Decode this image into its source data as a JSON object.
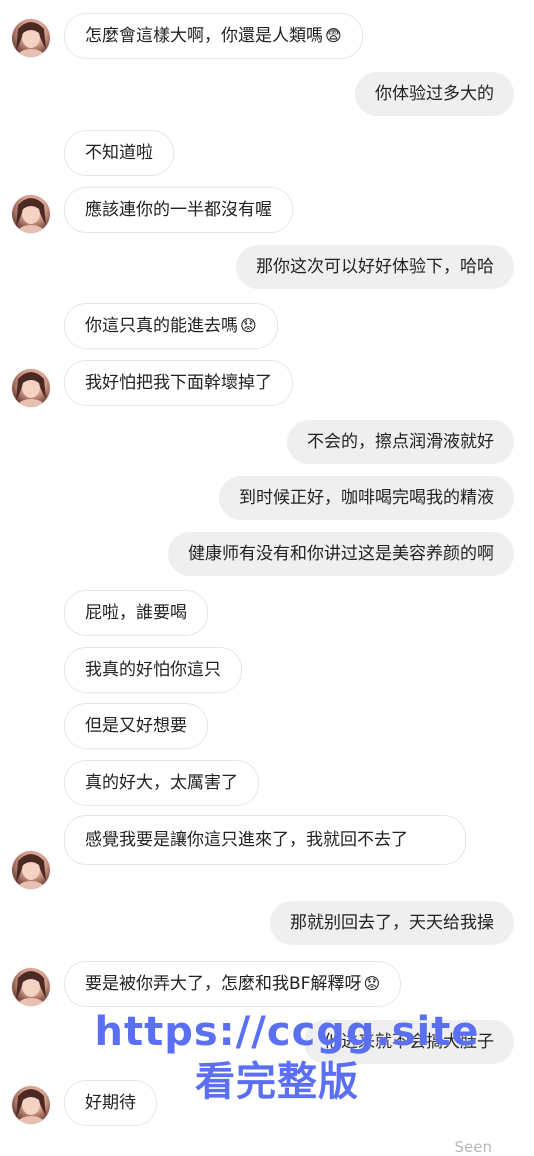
{
  "messages": [
    {
      "side": "in",
      "text": "怎麼會這樣大啊，你還是人類嗎",
      "emoji": "😨",
      "avatar": true
    },
    {
      "side": "out",
      "text": "你体验过多大的"
    },
    {
      "side": "in",
      "text": "不知道啦",
      "avatar": false
    },
    {
      "side": "in",
      "text": "應該連你的一半都沒有喔",
      "avatar": true
    },
    {
      "side": "out",
      "text": "那你这次可以好好体验下，哈哈"
    },
    {
      "side": "in",
      "text": "你這只真的能進去嗎",
      "emoji": "😟",
      "avatar": false
    },
    {
      "side": "in",
      "text": "我好怕把我下面幹壞掉了",
      "avatar": true
    },
    {
      "side": "out",
      "text": "不会的，擦点润滑液就好"
    },
    {
      "side": "out",
      "text": "到时候正好，咖啡喝完喝我的精液"
    },
    {
      "side": "out",
      "text": "健康师有没有和你讲过这是美容养颜的啊"
    },
    {
      "side": "in",
      "text": "屁啦，誰要喝",
      "avatar": false
    },
    {
      "side": "in",
      "text": "我真的好怕你這只",
      "avatar": false
    },
    {
      "side": "in",
      "text": "但是又好想要",
      "avatar": false
    },
    {
      "side": "in",
      "text": "真的好大，太厲害了",
      "avatar": false
    },
    {
      "side": "in",
      "text": "感覺我要是讓你這只進來了，我就回不去了",
      "avatar": true
    },
    {
      "side": "out",
      "text": "那就别回去了，天天给我操"
    },
    {
      "side": "in",
      "text": "要是被你弄大了，怎麼和我BF解釋呀",
      "emoji": "😟",
      "avatar": true
    },
    {
      "side": "out",
      "text": "他进来就不会搞大肚子"
    },
    {
      "side": "in",
      "text": "好期待",
      "avatar": true
    }
  ],
  "watermark": {
    "url": "https://ccgg.site",
    "sub": "看完整版",
    "color": "#5b6ff2"
  },
  "status": {
    "seen": "Seen"
  }
}
